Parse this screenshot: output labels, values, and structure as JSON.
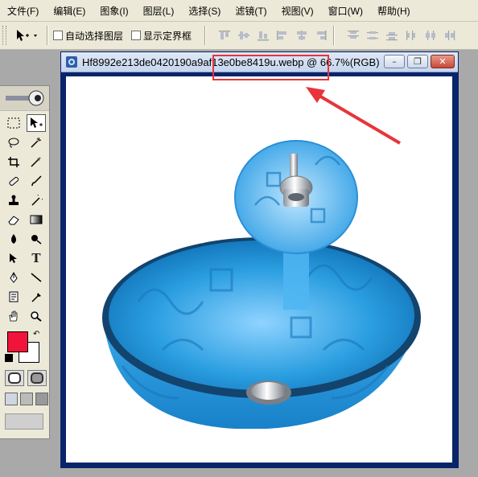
{
  "menu": [
    "文件(F)",
    "编辑(E)",
    "图象(I)",
    "图层(L)",
    "选择(S)",
    "滤镜(T)",
    "视图(V)",
    "窗口(W)",
    "帮助(H)"
  ],
  "options_bar": {
    "auto_select_layer": "自动选择图层",
    "show_bounding_box": "显示定界框"
  },
  "document": {
    "title": "Hf8992e213de0420190a9af13e0be8419u.webp @ 66.7%(RGB)",
    "image_subject": "blue glass vessel sink with waterfall faucet"
  },
  "window_buttons": {
    "minimize": "–",
    "restore": "❐",
    "close": "✕"
  },
  "colors": {
    "foreground": "#f2133a",
    "background": "#ffffff",
    "highlight": "#e8343a",
    "sink_blue": "#2a9ee0"
  },
  "tools": [
    "marquee-icon",
    "move-icon",
    "lasso-icon",
    "magic-wand-icon",
    "crop-icon",
    "slice-icon",
    "healing-icon",
    "brush-icon",
    "stamp-icon",
    "history-brush-icon",
    "eraser-icon",
    "gradient-icon",
    "blur-icon",
    "dodge-icon",
    "path-select-icon",
    "type-icon",
    "pen-icon",
    "line-icon",
    "notes-icon",
    "eyedropper-icon",
    "hand-icon",
    "zoom-icon"
  ]
}
